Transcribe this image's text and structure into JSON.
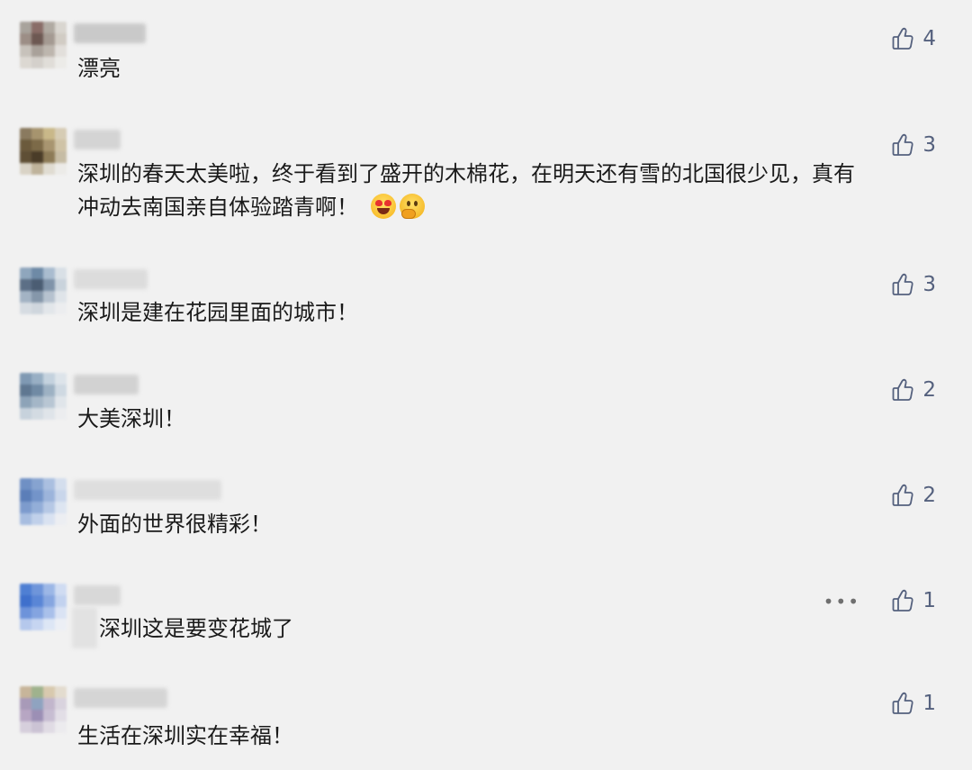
{
  "comments": [
    {
      "text": "漂亮",
      "likes": "4",
      "avatar_colors": [
        "#a8a39c",
        "#8a6d68",
        "#b0aaa2",
        "#d9d6d0",
        "#9c8e86",
        "#6d5852",
        "#a49a92",
        "#d1ccc4",
        "#c7c2bb",
        "#a9a19a",
        "#bdb6ae",
        "#e2dfdb",
        "#dcd8d2",
        "#d4d0cb",
        "#e0ddd8",
        "#ecebe8"
      ],
      "name_color": "#bdbdbd"
    },
    {
      "text": "深圳的春天太美啦，终于看到了盛开的木棉花，在明天还有雪的北国很少见，真有",
      "text2": "冲动去南国亲自体验踏青啊！",
      "likes": "3",
      "avatar_colors": [
        "#8a7a5f",
        "#a6946e",
        "#c9b889",
        "#d6ccb4",
        "#6b5a3c",
        "#7c6a48",
        "#a89570",
        "#cfc3a6",
        "#5f4f35",
        "#4a3c28",
        "#8d7b57",
        "#c6bca4",
        "#d9d3c6",
        "#bfb39b",
        "#e0dcd2",
        "#ecebe8"
      ],
      "name_color": "#c8c8c8"
    },
    {
      "text": "深圳是建在花园里面的城市！",
      "likes": "3",
      "avatar_colors": [
        "#8fa6bd",
        "#6e8aa6",
        "#a9bccf",
        "#d9e0e6",
        "#5c6f86",
        "#4b5d73",
        "#7f93a9",
        "#c9d3dc",
        "#a3b3c4",
        "#8597aa",
        "#b6c2cf",
        "#dfe4e9",
        "#d6dce2",
        "#cfd6dd",
        "#e2e6ea",
        "#ecedef"
      ],
      "name_color": "#d0d0d0"
    },
    {
      "text": "大美深圳！",
      "likes": "2",
      "avatar_colors": [
        "#7f99b3",
        "#98afc4",
        "#c4d2de",
        "#dde4ea",
        "#5f7791",
        "#708aa4",
        "#9db1c3",
        "#cfd9e2",
        "#8da3b8",
        "#a4b6c7",
        "#b8c6d3",
        "#e0e5ea",
        "#c7d2dc",
        "#d3dbe2",
        "#dfe4e9",
        "#ecedef"
      ],
      "name_color": "#c4c4c4"
    },
    {
      "text": "外面的世界很精彩！",
      "likes": "2",
      "avatar_colors": [
        "#6f90c4",
        "#86a3d0",
        "#aabfe0",
        "#d4deed",
        "#5b7eb8",
        "#7394c9",
        "#9cb4db",
        "#c9d6eb",
        "#7d9bcd",
        "#93aed8",
        "#b6c8e5",
        "#dde5f1",
        "#a7bde0",
        "#c0d0ea",
        "#d9e2f1",
        "#eceef2"
      ],
      "name_color": "#d6d6d6"
    },
    {
      "text": "深圳这是要变花城了",
      "likes": "1",
      "avatar_colors": [
        "#4f7fd3",
        "#6f95da",
        "#9cb7e6",
        "#d0dcf2",
        "#3f70cc",
        "#5a86d6",
        "#86a6e0",
        "#c2d2ef",
        "#6d93da",
        "#84a4e0",
        "#a9c0ea",
        "#dae3f4",
        "#b5c8ec",
        "#c6d5f1",
        "#dde6f5",
        "#eceff5"
      ],
      "name_color": "#c8c8c8"
    },
    {
      "text": "生活在深圳实在幸福！",
      "likes": "1",
      "avatar_colors": [
        "#c7b59a",
        "#9fb28d",
        "#d8c9ae",
        "#e3dccf",
        "#a89ab8",
        "#8fa3c0",
        "#c2b6cc",
        "#d9d3de",
        "#b7a6c3",
        "#9c8fb5",
        "#c7bdd2",
        "#e2dee6",
        "#d6cfdc",
        "#cbc3d4",
        "#e0dbe4",
        "#ecebee"
      ],
      "name_color": "#c9c9c9"
    }
  ],
  "more_label": "•••",
  "emoji_names": [
    "heart-eyes-emoji",
    "thinking-emoji"
  ]
}
